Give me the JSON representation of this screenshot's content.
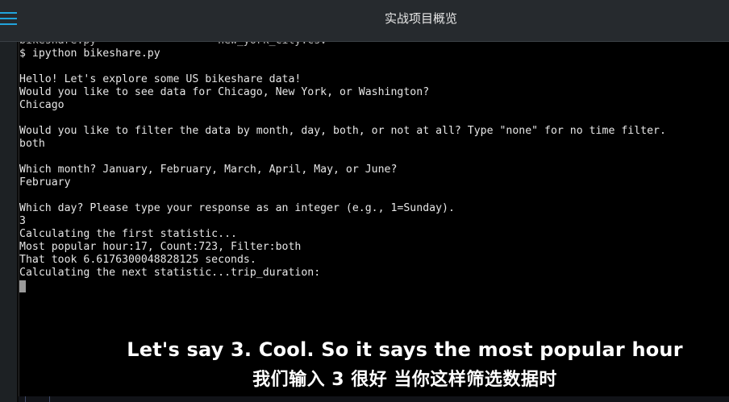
{
  "app": {
    "title": "实战项目概览",
    "menu_icon": "hamburger-menu-icon",
    "accent_color": "#21a4dc"
  },
  "terminal": {
    "lines": [
      {
        "text": "bikeshare.py                   new_york_city.csv",
        "clipped": true
      },
      {
        "text": "$ ipython bikeshare.py"
      },
      {
        "text": ""
      },
      {
        "text": "Hello! Let's explore some US bikeshare data!"
      },
      {
        "text": "Would you like to see data for Chicago, New York, or Washington?"
      },
      {
        "text": "Chicago"
      },
      {
        "text": ""
      },
      {
        "text": "Would you like to filter the data by month, day, both, or not at all? Type \"none\" for no time filter."
      },
      {
        "text": "both"
      },
      {
        "text": ""
      },
      {
        "text": "Which month? January, February, March, April, May, or June?"
      },
      {
        "text": "February"
      },
      {
        "text": ""
      },
      {
        "text": "Which day? Please type your response as an integer (e.g., 1=Sunday)."
      },
      {
        "text": "3"
      },
      {
        "text": "Calculating the first statistic..."
      },
      {
        "text": "Most popular hour:17, Count:723, Filter:both"
      },
      {
        "text": "That took 6.6176300048828125 seconds."
      },
      {
        "text": "Calculating the next statistic...trip_duration:"
      }
    ]
  },
  "subtitles": {
    "english": "Let's say 3. Cool. So it says the most popular hour",
    "chinese": "我们输入 3 很好 当你这样筛选数据时"
  }
}
